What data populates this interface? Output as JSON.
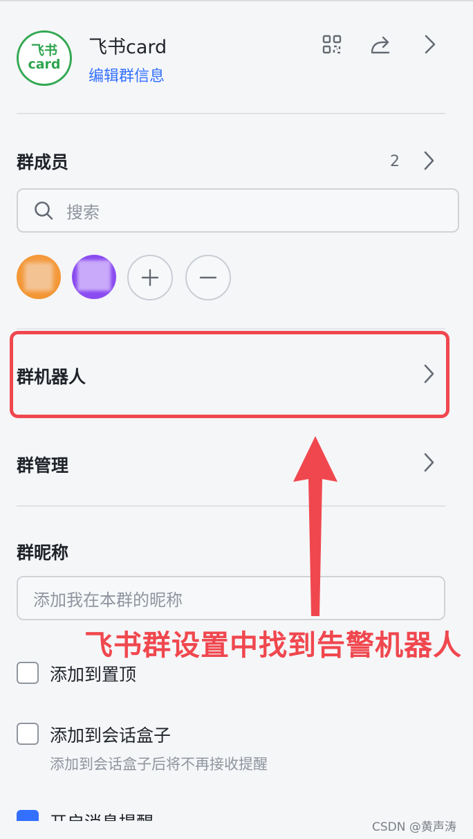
{
  "header": {
    "avatar_line1": "飞书",
    "avatar_line2": "card",
    "group_name": "飞书card",
    "edit_link": "编辑群信息",
    "icons": [
      "qr-code-icon",
      "share-icon",
      "chevron-right-icon"
    ]
  },
  "members": {
    "title": "群成员",
    "count": "2",
    "search_placeholder": "搜索",
    "add_icon": "plus-icon",
    "remove_icon": "minus-icon"
  },
  "rows": {
    "robots": "群机器人",
    "management": "群管理"
  },
  "nickname": {
    "title": "群昵称",
    "placeholder": "添加我在本群的昵称"
  },
  "options": [
    {
      "label": "添加到置顶",
      "checked": false
    },
    {
      "label": "添加到会话盒子",
      "sub": "添加到会话盒子后将不再接收提醒",
      "checked": false
    },
    {
      "label": "开启消息提醒",
      "checked": true
    }
  ],
  "annotation": "飞书群设置中找到告警机器人",
  "watermark": "CSDN @黄声涛",
  "colors": {
    "accent_blue": "#3370ff",
    "annotation_red": "#f0474e",
    "avatar_green": "#34a853"
  }
}
